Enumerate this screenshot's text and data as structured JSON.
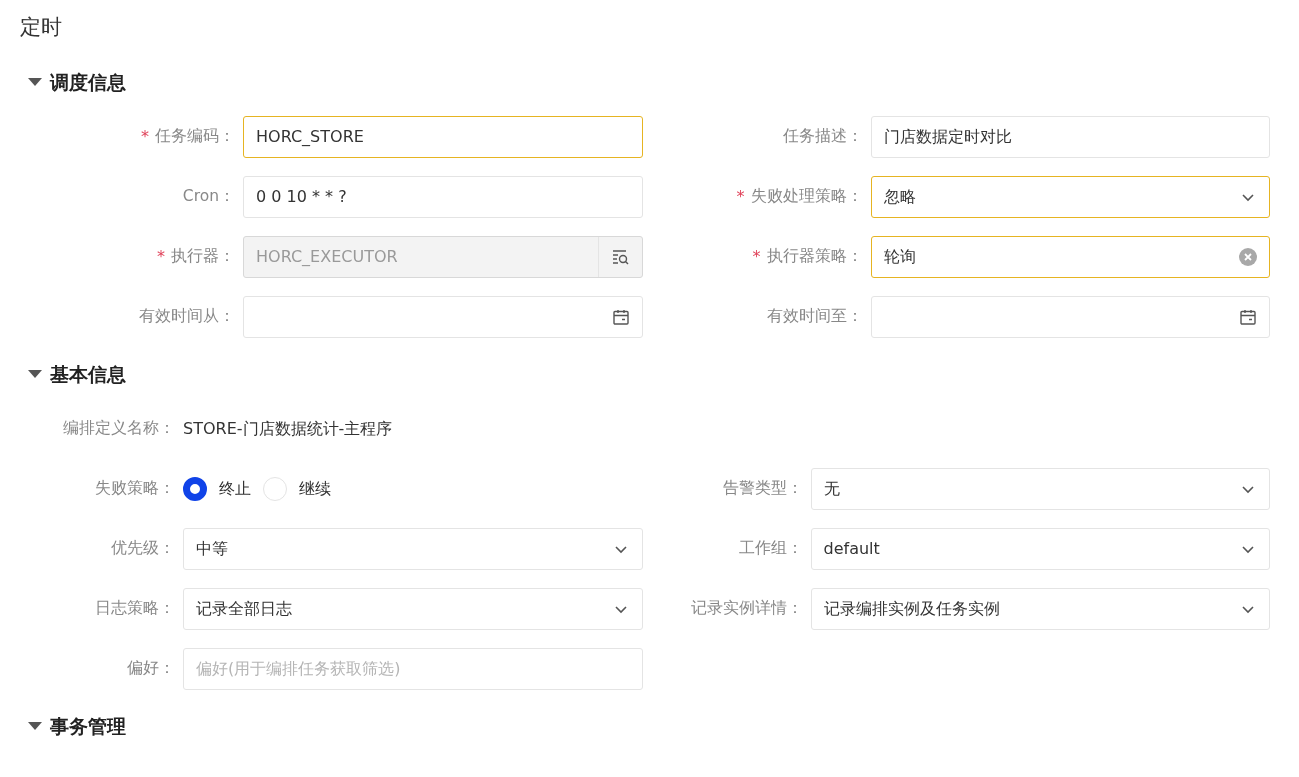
{
  "page_title": "定时",
  "sections": [
    {
      "title": "调度信息",
      "expanded": true,
      "rows": [
        [
          {
            "required_mark": "*",
            "label": "任务编码：",
            "kind": "text",
            "value": "HORC_STORE",
            "highlighted": true,
            "disabled": false
          },
          {
            "label": "任务描述：",
            "kind": "text",
            "value": "门店数据定时对比",
            "highlighted": false,
            "disabled": false
          }
        ],
        [
          {
            "label": "Cron：",
            "kind": "text",
            "value": "0 0 10 * * ?",
            "highlighted": false,
            "disabled": false
          },
          {
            "required_mark": "*",
            "label": "失败处理策略：",
            "kind": "select",
            "value": "忽略",
            "highlighted": true,
            "disabled": false
          }
        ],
        [
          {
            "required_mark": "*",
            "label": "执行器：",
            "kind": "lookup",
            "value": "HORC_EXECUTOR",
            "highlighted": false,
            "disabled": true
          },
          {
            "required_mark": "*",
            "label": "执行器策略：",
            "kind": "clearable",
            "value": "轮询",
            "highlighted": true,
            "disabled": false
          }
        ],
        [
          {
            "label": "有效时间从：",
            "kind": "date",
            "highlighted": false,
            "disabled": false
          },
          {
            "label": "有效时间至：",
            "kind": "date",
            "highlighted": false,
            "disabled": false
          }
        ]
      ]
    },
    {
      "title": "基本信息",
      "expanded": true,
      "rows": [
        [
          {
            "label": "编排定义名称：",
            "kind": "static",
            "value": "STORE-门店数据统计-主程序"
          }
        ],
        [
          {
            "label": "失败策略：",
            "kind": "radio",
            "options": [
              {
                "label": "终止",
                "selected": true
              },
              {
                "label": "继续",
                "selected": false
              }
            ]
          },
          {
            "label": "告警类型：",
            "kind": "select",
            "value": "无",
            "highlighted": false,
            "disabled": false
          }
        ],
        [
          {
            "label": "优先级：",
            "kind": "select",
            "value": "中等",
            "highlighted": false,
            "disabled": false
          },
          {
            "label": "工作组：",
            "kind": "select",
            "value": "default",
            "highlighted": false,
            "disabled": false
          }
        ],
        [
          {
            "label": "日志策略：",
            "kind": "select",
            "value": "记录全部日志",
            "highlighted": false,
            "disabled": false
          },
          {
            "label": "记录实例详情：",
            "kind": "select",
            "value": "记录编排实例及任务实例",
            "highlighted": false,
            "disabled": false
          }
        ],
        [
          {
            "label": "偏好：",
            "kind": "text",
            "placeholder": "偏好(用于编排任务获取筛选)",
            "highlighted": false,
            "disabled": false
          }
        ]
      ]
    },
    {
      "title": "事务管理",
      "expanded": true
    }
  ]
}
